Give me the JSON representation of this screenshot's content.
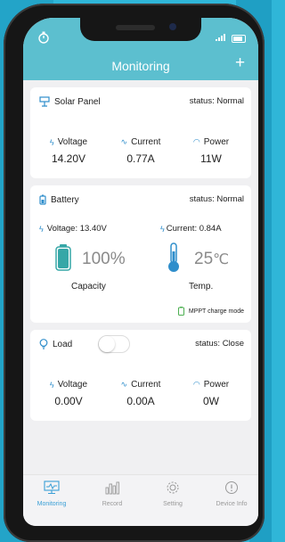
{
  "header": {
    "title": "Monitoring",
    "add_label": "+"
  },
  "solar": {
    "title": "Solar Panel",
    "status": "status: Normal",
    "metrics": [
      {
        "label": "Voltage",
        "value": "14.20V"
      },
      {
        "label": "Current",
        "value": "0.77A"
      },
      {
        "label": "Power",
        "value": "11W"
      }
    ]
  },
  "battery": {
    "title": "Battery",
    "status": "status: Normal",
    "voltage": "Voltage: 13.40V",
    "current": "Current:  0.84A",
    "capacity_value": "100%",
    "capacity_label": "Capacity",
    "temp_value": "25",
    "temp_unit": "℃",
    "temp_label": "Temp.",
    "mode_label": "MPPT charge mode",
    "capacity_fraction": 1.0
  },
  "load": {
    "title": "Load",
    "status": "status: Close",
    "switch_on": false,
    "metrics": [
      {
        "label": "Voltage",
        "value": "0.00V"
      },
      {
        "label": "Current",
        "value": "0.00A"
      },
      {
        "label": "Power",
        "value": "0W"
      }
    ]
  },
  "tabs": [
    {
      "label": "Monitoring",
      "active": true
    },
    {
      "label": "Record",
      "active": false
    },
    {
      "label": "Setting",
      "active": false
    },
    {
      "label": "Device Info",
      "active": false
    }
  ],
  "colors": {
    "accent": "#5cbfcf",
    "active_tab": "#3a9fd6",
    "battery_fill": "#36a7a7"
  }
}
